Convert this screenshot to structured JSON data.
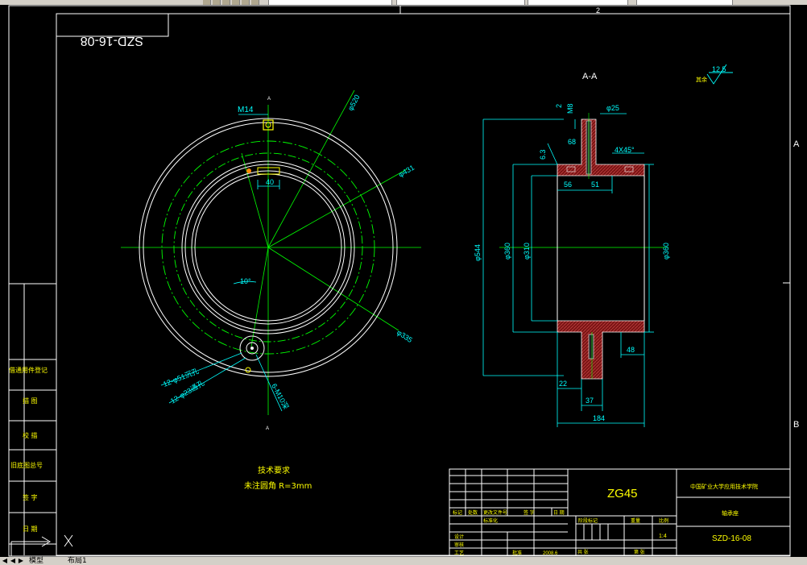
{
  "drawing": {
    "number": "SZD-16-08",
    "title_code_mirror": "SZD-16-08",
    "section_label": "A-A",
    "roughness_value": "12.5",
    "roughness_prefix": "其余",
    "material": "ZG45",
    "organization": "中国矿业大学应用技术学院",
    "part_name": "轴承座",
    "scale": "1:4",
    "date": "2008.6",
    "notes_title": "技术要求",
    "notes_line": "未注圆角 R=3mm"
  },
  "dimensions": {
    "m14": "M14",
    "d520": "φ520",
    "d431": "φ431",
    "d335": "φ335",
    "w40": "40",
    "angle10": "10°",
    "h51": "12-φ51沉孔",
    "h23": "12-φ23通孔",
    "m10": "6-M10深",
    "a_top": "A",
    "a_bot": "A",
    "m8": "M8",
    "two": "2",
    "d25": "φ25",
    "c68": "68",
    "r63": "6.3",
    "chamfer": "4X45°",
    "s56": "56",
    "s51": "51",
    "d544": "φ544",
    "d360l": "φ360",
    "d310": "φ310",
    "d360r": "φ360",
    "s48": "48",
    "s22": "22",
    "s37": "37",
    "s184": "184"
  },
  "side_panel": {
    "labels": [
      "借通用件登记",
      "描 图",
      "校 描",
      "旧底图总号",
      "签 字",
      "日 期"
    ]
  },
  "border_refs": {
    "top_mark": "2",
    "left_A": "A",
    "left_B": "B"
  },
  "title_block": {
    "row_labels": [
      "标记",
      "处数",
      "更改文件号",
      "签 字",
      "日 期"
    ],
    "designer": "设计",
    "standardization": "标准化",
    "checker": "审核",
    "process": "工艺",
    "approve": "批准",
    "stage_label": "阶段标记",
    "weight_label": "重量",
    "scale_label": "比例",
    "sheets": "共 张",
    "sheet_no": "第 张"
  },
  "statusbar": {
    "tab_model": "模型",
    "tab_layout": "布局1"
  },
  "colors": {
    "background": "#000000",
    "white_lines": "#ffffff",
    "green_lines": "#00ff00",
    "cyan_text": "#00ffff",
    "hatch": "#8b1a1a",
    "yellow": "#ffff00"
  }
}
